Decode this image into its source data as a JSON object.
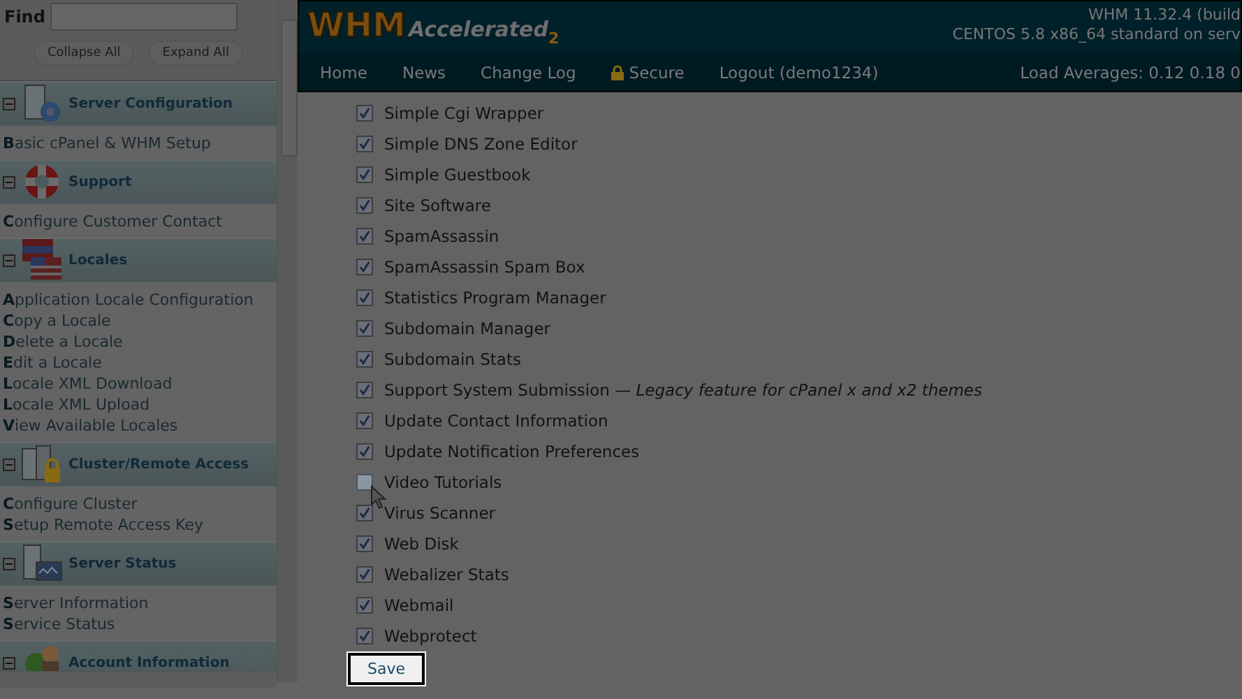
{
  "sidebar": {
    "find": {
      "label": "Find"
    },
    "buttons": [
      "Collapse All",
      "Expand All"
    ],
    "sections": [
      {
        "title": "Server Configuration",
        "expanded": true,
        "items": [
          "Basic cPanel & WHM Setup"
        ]
      },
      {
        "title": "Support",
        "expanded": true,
        "items": [
          "Configure Customer Contact"
        ]
      },
      {
        "title": "Locales",
        "expanded": true,
        "items": [
          "Application Locale Configuration",
          "Copy a Locale",
          "Delete a Locale",
          "Edit a Locale",
          "Locale XML Download",
          "Locale XML Upload",
          "View Available Locales"
        ]
      },
      {
        "title": "Cluster/Remote Access",
        "expanded": true,
        "items": [
          "Configure Cluster",
          "Setup Remote Access Key"
        ]
      },
      {
        "title": "Server Status",
        "expanded": true,
        "items": [
          "Server Information",
          "Service Status"
        ]
      },
      {
        "title": "Account Information",
        "expanded": true
      }
    ]
  },
  "header": {
    "logo": {
      "main": "WHM",
      "sub": "Accelerated",
      "suffix": "2"
    },
    "version": "WHM 11.32.4 (build",
    "system": "CENTOS 5.8 x86_64 standard on serv",
    "nav": [
      {
        "label": "Home",
        "kind": "link"
      },
      {
        "label": "News",
        "kind": "link"
      },
      {
        "label": "Change Log",
        "kind": "link"
      },
      {
        "label": "Secure",
        "kind": "lock"
      },
      {
        "label": "Logout (demo1234)",
        "kind": "link"
      }
    ],
    "load": "Load Averages: 0.12 0.18 0"
  },
  "features": [
    {
      "label": "Simple Cgi Wrapper",
      "checked": true
    },
    {
      "label": "Simple DNS Zone Editor",
      "checked": true
    },
    {
      "label": "Simple Guestbook",
      "checked": true
    },
    {
      "label": "Site Software",
      "checked": true
    },
    {
      "label": "SpamAssassin",
      "checked": true
    },
    {
      "label": "SpamAssassin Spam Box",
      "checked": true
    },
    {
      "label": "Statistics Program Manager",
      "checked": true
    },
    {
      "label": "Subdomain Manager",
      "checked": true
    },
    {
      "label": "Subdomain Stats",
      "checked": true
    },
    {
      "label": "Support System Submission — *Legacy feature for cPanel x and x2 themes*",
      "checked": true
    },
    {
      "label": "Update Contact Information",
      "checked": true
    },
    {
      "label": "Update Notification Preferences",
      "checked": true
    },
    {
      "label": "Video Tutorials",
      "checked": false,
      "cursor": true
    },
    {
      "label": "Virus Scanner",
      "checked": true
    },
    {
      "label": "Web Disk",
      "checked": true
    },
    {
      "label": "Webalizer Stats",
      "checked": true
    },
    {
      "label": "Webmail",
      "checked": true
    },
    {
      "label": "Webprotect",
      "checked": true
    }
  ],
  "save": "Save"
}
